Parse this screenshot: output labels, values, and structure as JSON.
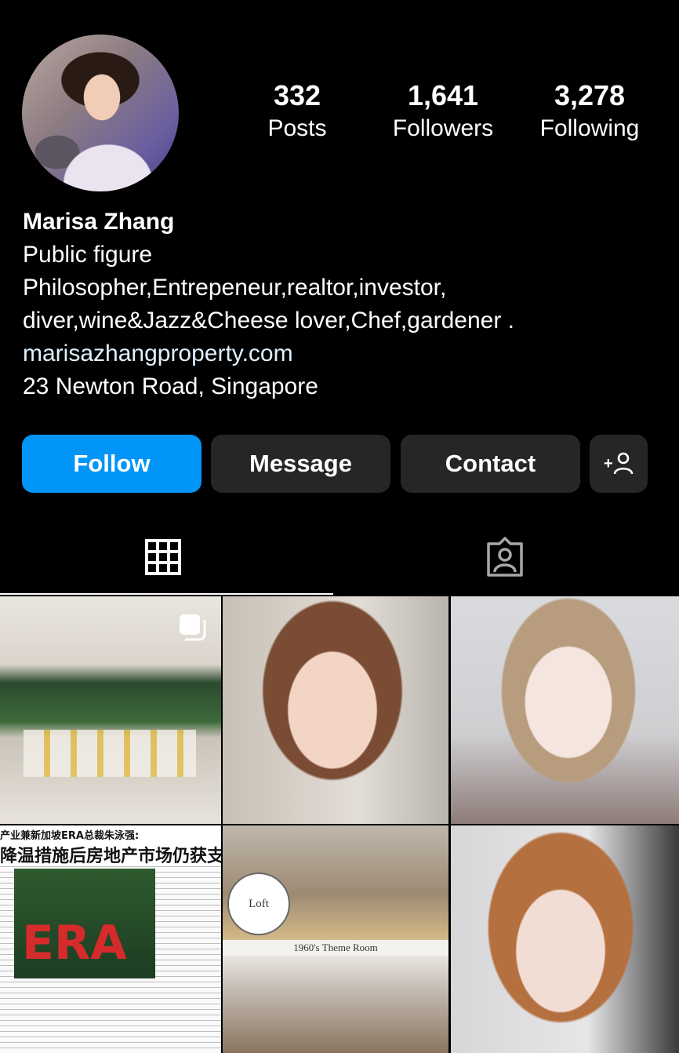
{
  "profile": {
    "stats": {
      "posts": {
        "value": "332",
        "label": "Posts"
      },
      "followers": {
        "value": "1,641",
        "label": "Followers"
      },
      "following": {
        "value": "3,278",
        "label": "Following"
      }
    },
    "name": "Marisa Zhang",
    "category": "Public figure",
    "bio_line1": "Philosopher,Entrepeneur,realtor,investor,",
    "bio_line2": "diver,wine&Jazz&Cheese lover,Chef,gardener .",
    "website": "marisazhangproperty.com",
    "address": "23 Newton Road, Singapore"
  },
  "actions": {
    "follow": "Follow",
    "message": "Message",
    "contact": "Contact",
    "suggest_icon": "add-person-icon"
  },
  "tabs": {
    "grid_icon": "grid-icon",
    "tagged_icon": "tagged-icon",
    "active": "grid"
  },
  "posts": [
    {
      "type": "restaurant-photo",
      "multi": true
    },
    {
      "type": "selfie"
    },
    {
      "type": "selfie"
    },
    {
      "type": "newspaper",
      "headline1": "产业兼新加坡ERA总裁朱泳强:",
      "headline2": "降温措施后房地产市场仍获支",
      "logo_text": "ERA"
    },
    {
      "type": "hotel-rooms",
      "loft_label": "Loft",
      "theme_label": "1960's Theme Room"
    },
    {
      "type": "selfie"
    }
  ],
  "colors": {
    "primary": "#0095f6",
    "secondary_button": "#262626",
    "background": "#000000",
    "link": "#e0f1ff"
  }
}
